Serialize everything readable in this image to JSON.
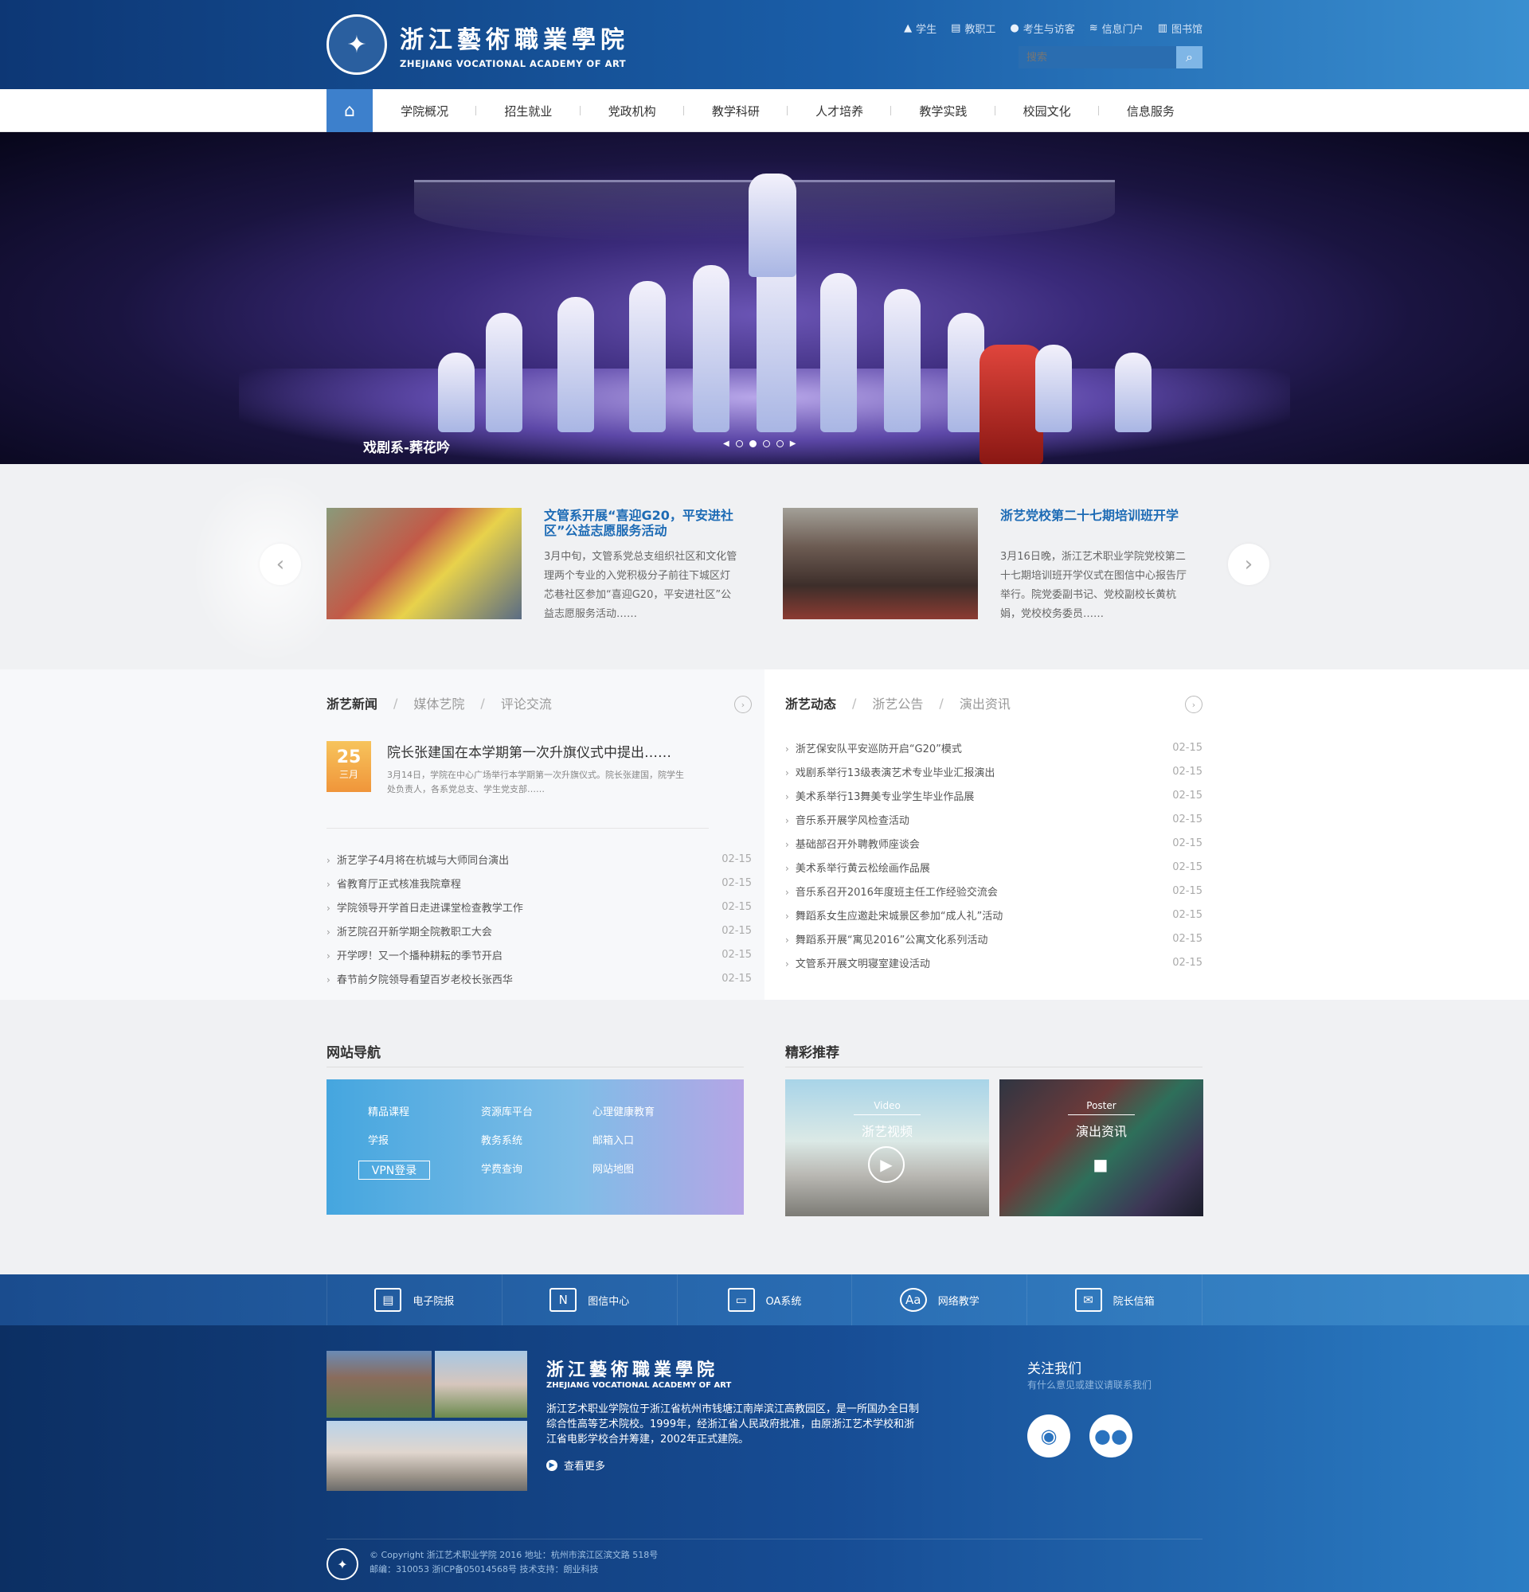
{
  "header": {
    "logo_cn": "浙江藝術職業學院",
    "logo_en": "ZHEJIANG VOCATIONAL ACADEMY OF ART",
    "top_links": [
      {
        "label": "学生",
        "icon": "graduation-cap-icon"
      },
      {
        "label": "教职工",
        "icon": "id-card-icon"
      },
      {
        "label": "考生与访客",
        "icon": "users-icon"
      },
      {
        "label": "信息门户",
        "icon": "layers-icon"
      },
      {
        "label": "图书馆",
        "icon": "book-icon"
      }
    ],
    "search_placeholder": "搜索"
  },
  "nav": {
    "items": [
      "学院概况",
      "招生就业",
      "党政机构",
      "教学科研",
      "人才培养",
      "教学实践",
      "校园文化",
      "信息服务"
    ]
  },
  "banner": {
    "caption": "戏剧系-葬花吟",
    "slides": 4,
    "active_slide": 2
  },
  "slider": {
    "cards": [
      {
        "title": "文管系开展“喜迎G20，平安进社区”公益志愿服务活动",
        "desc": "3月中旬，文管系党总支组织社区和文化管理两个专业的入党积极分子前往下城区灯芯巷社区参加“喜迎G20，平安进社区”公益志愿服务活动……"
      },
      {
        "title": "浙艺党校第二十七期培训班开学",
        "desc": "3月16日晚，浙江艺术职业学院党校第二十七期培训班开学仪式在图信中心报告厅举行。院党委副书记、党校副校长黄杭娟，党校校务委员……"
      }
    ]
  },
  "news": {
    "tabs": [
      "浙艺新闻",
      "媒体艺院",
      "评论交流"
    ],
    "feature": {
      "day": "25",
      "month": "三月",
      "title": "院长张建国在本学期第一次升旗仪式中提出……",
      "desc": "3月14日，学院在中心广场举行本学期第一次升旗仪式。院长张建国，院学生处负责人，各系党总支、学生党支部……"
    },
    "items": [
      {
        "title": "浙艺学子4月将在杭城与大师同台演出",
        "date": "02-15"
      },
      {
        "title": "省教育厅正式核准我院章程",
        "date": "02-15"
      },
      {
        "title": "学院领导开学首日走进课堂检查教学工作",
        "date": "02-15"
      },
      {
        "title": "浙艺院召开新学期全院教职工大会",
        "date": "02-15"
      },
      {
        "title": "开学啰！又一个播种耕耘的季节开启",
        "date": "02-15"
      },
      {
        "title": "春节前夕院领导看望百岁老校长张西华",
        "date": "02-15"
      }
    ]
  },
  "dynamics": {
    "tabs": [
      "浙艺动态",
      "浙艺公告",
      "演出资讯"
    ],
    "items": [
      {
        "title": "浙艺保安队平安巡防开启“G20”模式",
        "date": "02-15"
      },
      {
        "title": "戏剧系举行13级表演艺术专业毕业汇报演出",
        "date": "02-15"
      },
      {
        "title": "美术系举行13舞美专业学生毕业作品展",
        "date": "02-15"
      },
      {
        "title": "音乐系开展学风检查活动",
        "date": "02-15"
      },
      {
        "title": "基础部召开外聘教师座谈会",
        "date": "02-15"
      },
      {
        "title": "美术系举行黄云松绘画作品展",
        "date": "02-15"
      },
      {
        "title": "音乐系召开2016年度班主任工作经验交流会",
        "date": "02-15"
      },
      {
        "title": "舞蹈系女生应邀赴宋城景区参加“成人礼”活动",
        "date": "02-15"
      },
      {
        "title": "舞蹈系开展“寓见2016”公寓文化系列活动",
        "date": "02-15"
      },
      {
        "title": "文管系开展文明寝室建设活动",
        "date": "02-15"
      }
    ]
  },
  "site_nav": {
    "title": "网站导航",
    "links": [
      "精品课程",
      "资源库平台",
      "心理健康教育",
      "学报",
      "教务系统",
      "邮箱入口",
      "VPN登录",
      "学费查询",
      "网站地图"
    ]
  },
  "recommend": {
    "title": "精彩推荐",
    "items": [
      {
        "label_en": "Video",
        "label_cn": "浙艺视频",
        "icon": "play-icon"
      },
      {
        "label_en": "Poster",
        "label_cn": "演出资讯",
        "icon": "camera-icon"
      }
    ]
  },
  "strip": {
    "items": [
      {
        "label": "电子院报",
        "icon": "newspaper-icon"
      },
      {
        "label": "图信中心",
        "icon": "document-icon"
      },
      {
        "label": "OA系统",
        "icon": "window-icon"
      },
      {
        "label": "网络教学",
        "icon": "teaching-icon"
      },
      {
        "label": "院长信箱",
        "icon": "mail-icon"
      }
    ]
  },
  "footer": {
    "logo_cn": "浙江藝術職業學院",
    "logo_en": "ZHEJIANG VOCATIONAL ACADEMY OF ART",
    "desc": "浙江艺术职业学院位于浙江省杭州市钱塘江南岸滨江高教园区，是一所国办全日制综合性高等艺术院校。1999年，经浙江省人民政府批准，由原浙江艺术学校和浙江省电影学校合并筹建，2002年正式建院。",
    "more": "查看更多",
    "follow_title": "关注我们",
    "follow_sub": "有什么意见或建议请联系我们",
    "social": [
      {
        "icon": "weibo-icon"
      },
      {
        "icon": "wechat-icon"
      }
    ],
    "copyright": "© Copyright 浙江艺术职业学院 2016  地址：杭州市滨江区滨文路 518号",
    "icp": "邮编：310053 浙ICP备05014568号 技术支持：朗业科技"
  }
}
